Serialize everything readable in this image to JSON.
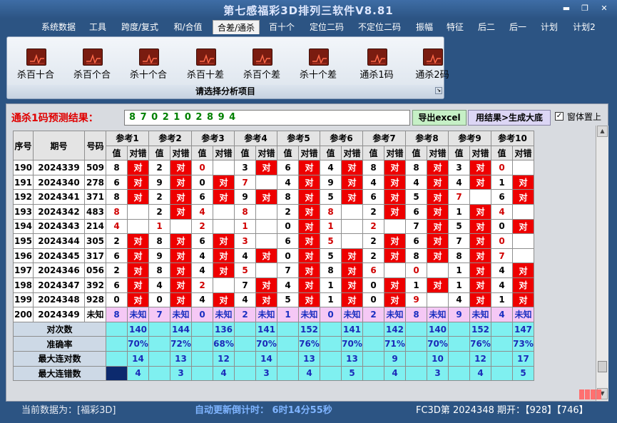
{
  "window": {
    "title": "第七感福彩3D排列三软件V8.81",
    "controls": [
      "▬",
      "❐",
      "✕"
    ]
  },
  "menu": [
    {
      "label": "系统数据"
    },
    {
      "label": "工具"
    },
    {
      "label": "跨度/复式"
    },
    {
      "label": "和/合值"
    },
    {
      "label": "合差/通杀"
    },
    {
      "label": "百十个"
    },
    {
      "label": "定位二码"
    },
    {
      "label": "不定位二码"
    },
    {
      "label": "振幅"
    },
    {
      "label": "特征"
    },
    {
      "label": "后二"
    },
    {
      "label": "后一"
    },
    {
      "label": "计划"
    },
    {
      "label": "计划2"
    }
  ],
  "ribbon": {
    "buttons": [
      {
        "label": "杀百十合",
        "icon": "chart-icon"
      },
      {
        "label": "杀百个合",
        "icon": "chart-icon"
      },
      {
        "label": "杀十个合",
        "icon": "chart-icon"
      },
      {
        "label": "杀百十差",
        "icon": "chart-icon"
      },
      {
        "label": "杀百个差",
        "icon": "chart-icon"
      },
      {
        "label": "杀十个差",
        "icon": "chart-icon"
      },
      {
        "label": "通杀1码",
        "icon": "chart-icon"
      },
      {
        "label": "通杀2码",
        "icon": "chart-icon"
      }
    ],
    "footer": "请选择分析项目"
  },
  "prediction": {
    "label": "通杀1码预测结果：",
    "value": "8 7 0 2 1 0 2 8 9 4",
    "export_label": "导出excel",
    "generate_label": "用结果>生成大底",
    "ontop_label": "窗体置上",
    "ontop_checked": "✓"
  },
  "table": {
    "headers": {
      "seq": "序号",
      "period": "期号",
      "code": "号码",
      "refs": [
        "参考1",
        "参考2",
        "参考3",
        "参考4",
        "参考5",
        "参考6",
        "参考7",
        "参考8",
        "参考9",
        "参考10"
      ],
      "val": "值",
      "hit": "对错"
    },
    "rows": [
      {
        "seq": "190",
        "period": "2024339",
        "code": "509",
        "refs": [
          [
            "8",
            "对"
          ],
          [
            "2",
            "对"
          ],
          [
            "0",
            ""
          ],
          [
            "3",
            "对"
          ],
          [
            "6",
            "对"
          ],
          [
            "4",
            "对"
          ],
          [
            "8",
            "对"
          ],
          [
            "8",
            "对"
          ],
          [
            "3",
            "对"
          ],
          [
            "0",
            ""
          ]
        ]
      },
      {
        "seq": "191",
        "period": "2024340",
        "code": "278",
        "refs": [
          [
            "6",
            "对"
          ],
          [
            "9",
            "对"
          ],
          [
            "0",
            "对"
          ],
          [
            "7",
            ""
          ],
          [
            "4",
            "对"
          ],
          [
            "9",
            "对"
          ],
          [
            "4",
            "对"
          ],
          [
            "4",
            "对"
          ],
          [
            "4",
            "对"
          ],
          [
            "1",
            "对"
          ]
        ]
      },
      {
        "seq": "192",
        "period": "2024341",
        "code": "371",
        "refs": [
          [
            "8",
            "对"
          ],
          [
            "2",
            "对"
          ],
          [
            "6",
            "对"
          ],
          [
            "9",
            "对"
          ],
          [
            "8",
            "对"
          ],
          [
            "5",
            "对"
          ],
          [
            "6",
            "对"
          ],
          [
            "5",
            "对"
          ],
          [
            "7",
            ""
          ],
          [
            "6",
            "对"
          ]
        ]
      },
      {
        "seq": "193",
        "period": "2024342",
        "code": "483",
        "refs": [
          [
            "8",
            ""
          ],
          [
            "2",
            "对"
          ],
          [
            "4",
            ""
          ],
          [
            "8",
            ""
          ],
          [
            "2",
            "对"
          ],
          [
            "8",
            ""
          ],
          [
            "2",
            "对"
          ],
          [
            "6",
            "对"
          ],
          [
            "1",
            "对"
          ],
          [
            "4",
            ""
          ]
        ]
      },
      {
        "seq": "194",
        "period": "2024343",
        "code": "214",
        "refs": [
          [
            "4",
            ""
          ],
          [
            "1",
            ""
          ],
          [
            "2",
            ""
          ],
          [
            "1",
            ""
          ],
          [
            "0",
            "对"
          ],
          [
            "1",
            ""
          ],
          [
            "2",
            ""
          ],
          [
            "7",
            "对"
          ],
          [
            "5",
            "对"
          ],
          [
            "0",
            "对"
          ]
        ]
      },
      {
        "seq": "195",
        "period": "2024344",
        "code": "305",
        "refs": [
          [
            "2",
            "对"
          ],
          [
            "8",
            "对"
          ],
          [
            "6",
            "对"
          ],
          [
            "3",
            ""
          ],
          [
            "6",
            "对"
          ],
          [
            "5",
            ""
          ],
          [
            "2",
            "对"
          ],
          [
            "6",
            "对"
          ],
          [
            "7",
            "对"
          ],
          [
            "0",
            ""
          ]
        ]
      },
      {
        "seq": "196",
        "period": "2024345",
        "code": "317",
        "refs": [
          [
            "6",
            "对"
          ],
          [
            "9",
            "对"
          ],
          [
            "4",
            "对"
          ],
          [
            "4",
            "对"
          ],
          [
            "0",
            "对"
          ],
          [
            "5",
            "对"
          ],
          [
            "2",
            "对"
          ],
          [
            "8",
            "对"
          ],
          [
            "8",
            "对"
          ],
          [
            "7",
            ""
          ]
        ]
      },
      {
        "seq": "197",
        "period": "2024346",
        "code": "056",
        "refs": [
          [
            "2",
            "对"
          ],
          [
            "8",
            "对"
          ],
          [
            "4",
            "对"
          ],
          [
            "5",
            ""
          ],
          [
            "7",
            "对"
          ],
          [
            "8",
            "对"
          ],
          [
            "6",
            ""
          ],
          [
            "0",
            ""
          ],
          [
            "1",
            "对"
          ],
          [
            "4",
            "对"
          ]
        ]
      },
      {
        "seq": "198",
        "period": "2024347",
        "code": "392",
        "refs": [
          [
            "6",
            "对"
          ],
          [
            "4",
            "对"
          ],
          [
            "2",
            ""
          ],
          [
            "7",
            "对"
          ],
          [
            "4",
            "对"
          ],
          [
            "1",
            "对"
          ],
          [
            "0",
            "对"
          ],
          [
            "1",
            "对"
          ],
          [
            "1",
            "对"
          ],
          [
            "4",
            "对"
          ]
        ]
      },
      {
        "seq": "199",
        "period": "2024348",
        "code": "928",
        "refs": [
          [
            "0",
            "对"
          ],
          [
            "0",
            "对"
          ],
          [
            "4",
            "对"
          ],
          [
            "4",
            "对"
          ],
          [
            "5",
            "对"
          ],
          [
            "1",
            "对"
          ],
          [
            "0",
            "对"
          ],
          [
            "9",
            ""
          ],
          [
            "4",
            "对"
          ],
          [
            "1",
            "对"
          ]
        ]
      },
      {
        "seq": "200",
        "period": "2024349",
        "code": "未知",
        "refs": [
          [
            "8",
            "未知"
          ],
          [
            "7",
            "未知"
          ],
          [
            "0",
            "未知"
          ],
          [
            "2",
            "未知"
          ],
          [
            "1",
            "未知"
          ],
          [
            "0",
            "未知"
          ],
          [
            "2",
            "未知"
          ],
          [
            "8",
            "未知"
          ],
          [
            "9",
            "未知"
          ],
          [
            "4",
            "未知"
          ]
        ]
      }
    ],
    "stats": [
      {
        "label": "对次数",
        "values": [
          "140",
          "144",
          "136",
          "141",
          "152",
          "141",
          "142",
          "140",
          "152",
          "147"
        ]
      },
      {
        "label": "准确率",
        "values": [
          "70%",
          "72%",
          "68%",
          "70%",
          "76%",
          "70%",
          "71%",
          "70%",
          "76%",
          "73%"
        ]
      },
      {
        "label": "最大连对数",
        "values": [
          "14",
          "13",
          "12",
          "14",
          "13",
          "13",
          "9",
          "10",
          "12",
          "17"
        ]
      },
      {
        "label": "最大连错数",
        "values": [
          "4",
          "3",
          "4",
          "3",
          "4",
          "5",
          "4",
          "3",
          "4",
          "5"
        ]
      }
    ]
  },
  "status": {
    "current_data": "当前数据为：[福彩3D]",
    "countdown": "自动更新倒计时： 6时14分55秒",
    "latest": "FC3D第 2024348 期开：【928】【746】"
  },
  "colors": {
    "hit_red": "#ee0000",
    "unknown_pink": "#f5c8f5",
    "stats_cyan": "#7ff0f0",
    "prediction_green": "#008000",
    "background_blue": "#2c5483"
  }
}
